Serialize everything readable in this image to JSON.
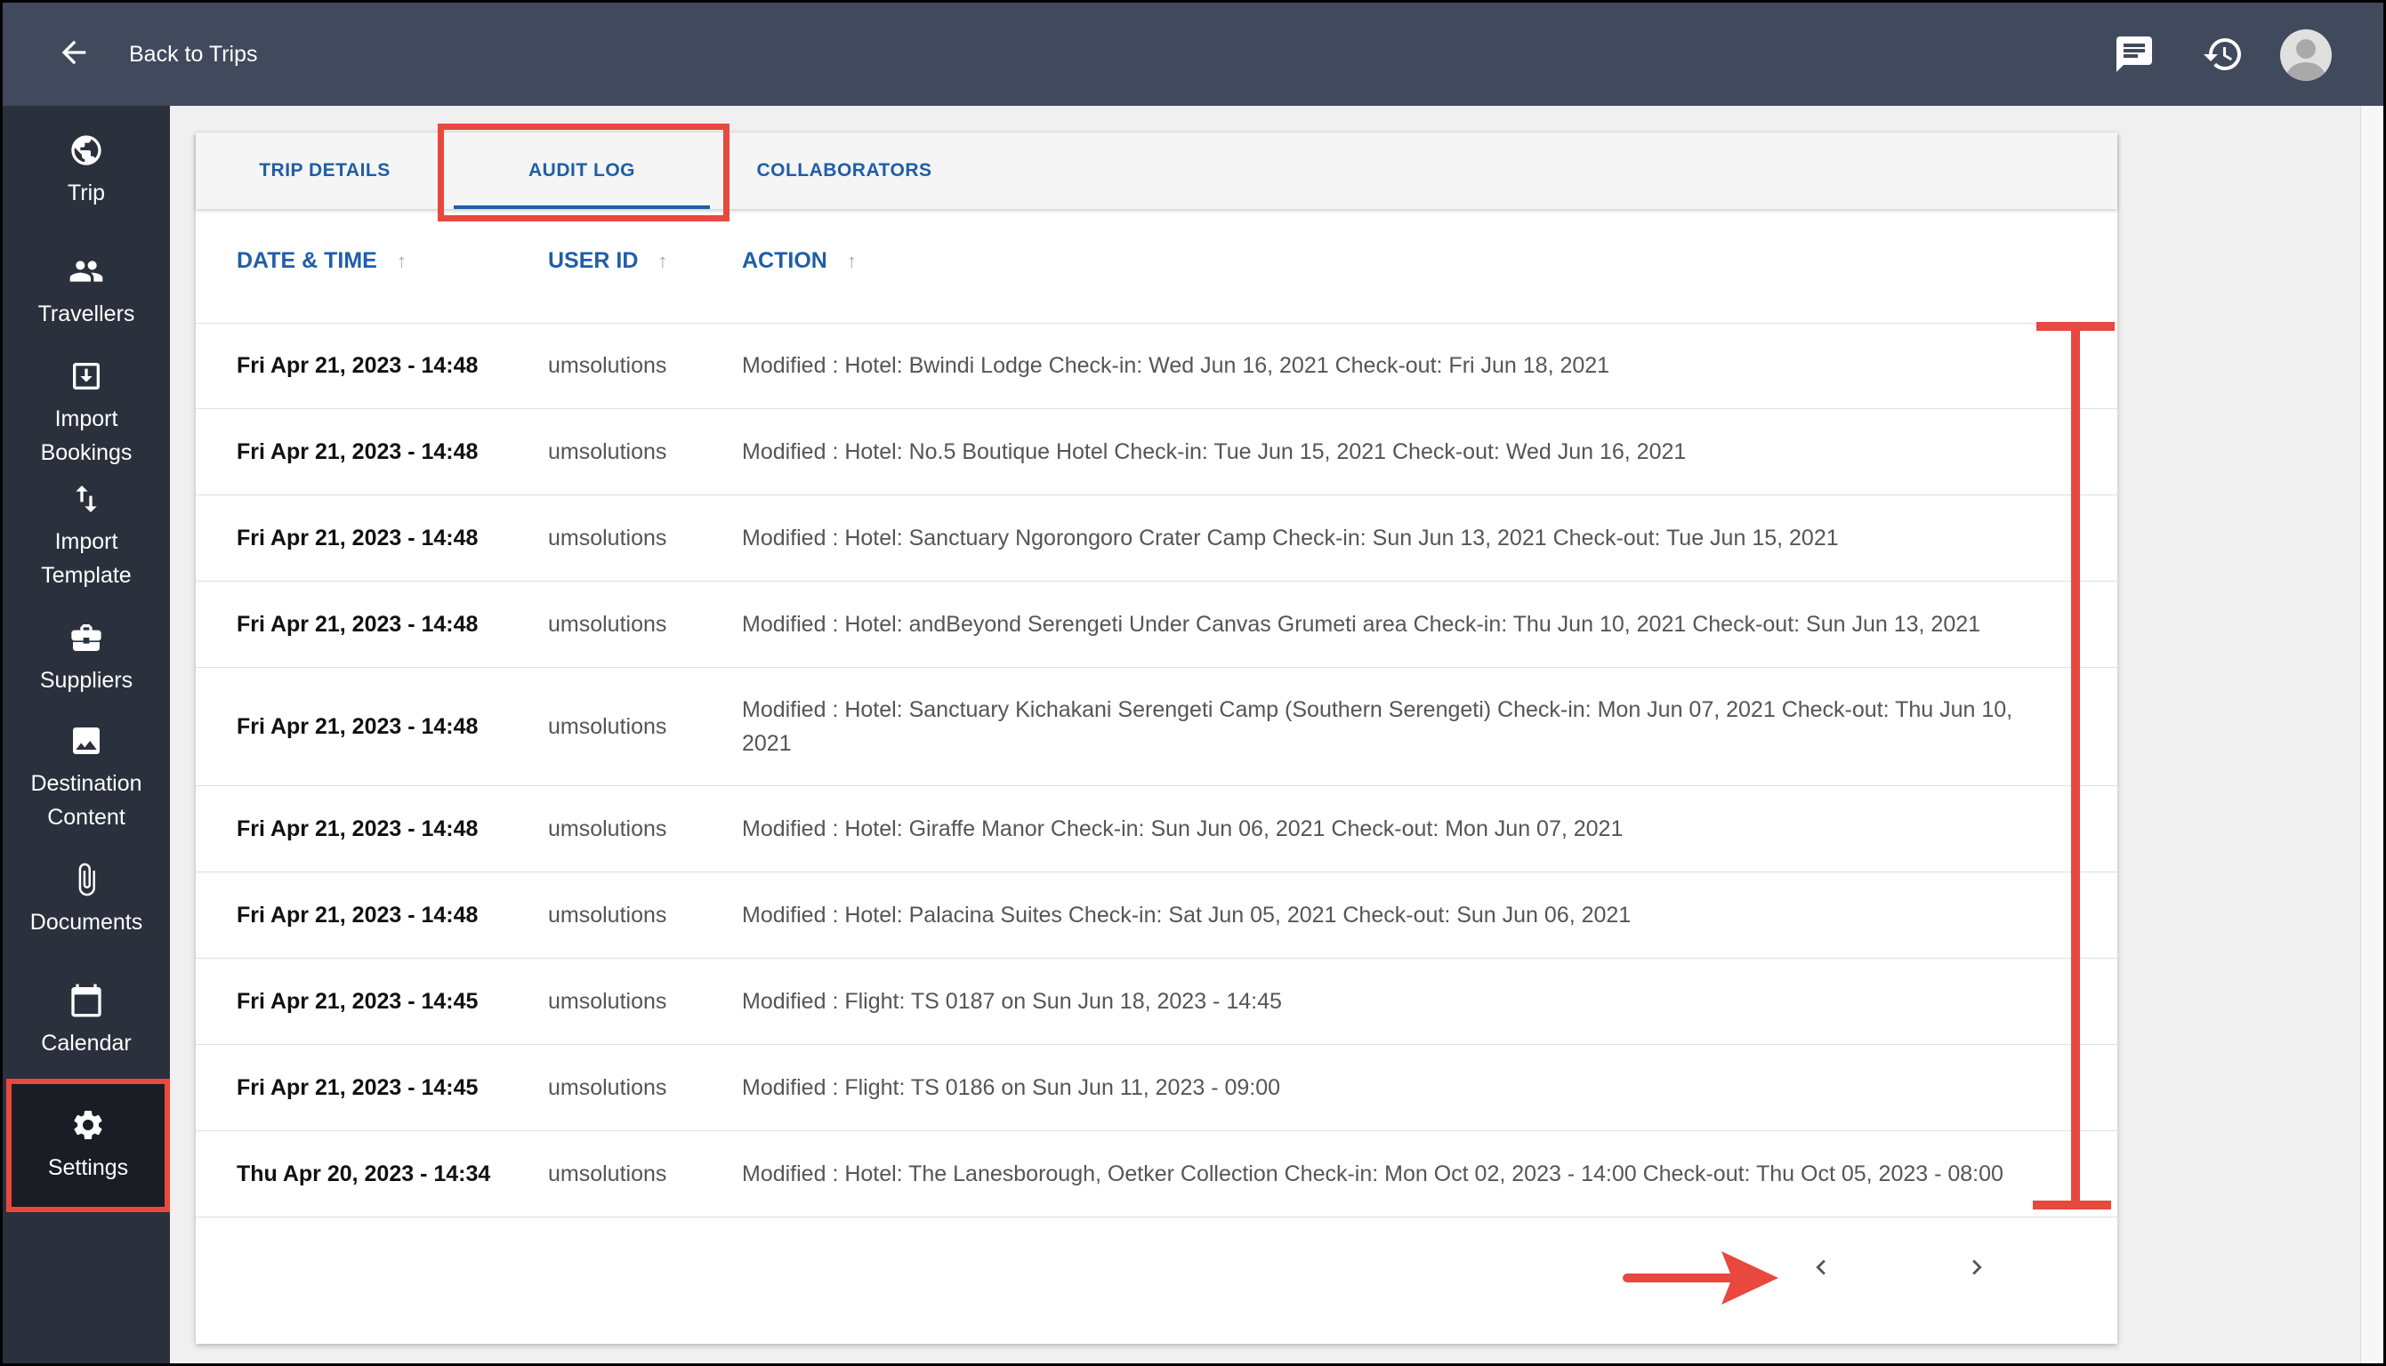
{
  "header": {
    "back_label": "Back to Trips",
    "icons": [
      "arrow-left-icon",
      "chat-icon",
      "history-icon",
      "user-avatar"
    ]
  },
  "sidebar": {
    "items": [
      {
        "label": "Trip",
        "icon": "globe-icon"
      },
      {
        "label": "Travellers",
        "icon": "people-icon"
      },
      {
        "label": "Import\nBookings",
        "icon": "import-icon"
      },
      {
        "label": "Import\nTemplate",
        "icon": "swap-vertical-icon"
      },
      {
        "label": "Suppliers",
        "icon": "briefcase-icon"
      },
      {
        "label": "Destination\nContent",
        "icon": "image-icon"
      },
      {
        "label": "Documents",
        "icon": "paperclip-icon"
      },
      {
        "label": "Calendar",
        "icon": "calendar-icon"
      },
      {
        "label": "Settings",
        "icon": "gear-icon",
        "selected": true
      }
    ]
  },
  "tabs": [
    {
      "label": "TRIP DETAILS"
    },
    {
      "label": "AUDIT LOG",
      "active": true
    },
    {
      "label": "COLLABORATORS"
    }
  ],
  "table": {
    "columns": [
      "DATE & TIME",
      "USER ID",
      "ACTION"
    ],
    "rows": [
      {
        "date": "Fri Apr 21, 2023 - 14:48",
        "user": "umsolutions",
        "action": "Modified : Hotel: Bwindi Lodge Check-in: Wed Jun 16, 2021 Check-out: Fri Jun 18, 2021"
      },
      {
        "date": "Fri Apr 21, 2023 - 14:48",
        "user": "umsolutions",
        "action": "Modified : Hotel: No.5 Boutique Hotel Check-in: Tue Jun 15, 2021 Check-out: Wed Jun 16, 2021"
      },
      {
        "date": "Fri Apr 21, 2023 - 14:48",
        "user": "umsolutions",
        "action": "Modified : Hotel: Sanctuary Ngorongoro Crater Camp Check-in: Sun Jun 13, 2021 Check-out: Tue Jun 15, 2021"
      },
      {
        "date": "Fri Apr 21, 2023 - 14:48",
        "user": "umsolutions",
        "action": "Modified : Hotel: andBeyond Serengeti Under Canvas Grumeti area Check-in: Thu Jun 10, 2021 Check-out: Sun Jun 13, 2021"
      },
      {
        "date": "Fri Apr 21, 2023 - 14:48",
        "user": "umsolutions",
        "action": "Modified : Hotel: Sanctuary Kichakani Serengeti Camp (Southern Serengeti) Check-in: Mon Jun 07, 2021 Check-out: Thu Jun 10, 2021"
      },
      {
        "date": "Fri Apr 21, 2023 - 14:48",
        "user": "umsolutions",
        "action": "Modified : Hotel: Giraffe Manor Check-in: Sun Jun 06, 2021 Check-out: Mon Jun 07, 2021"
      },
      {
        "date": "Fri Apr 21, 2023 - 14:48",
        "user": "umsolutions",
        "action": "Modified : Hotel: Palacina Suites Check-in: Sat Jun 05, 2021 Check-out: Sun Jun 06, 2021"
      },
      {
        "date": "Fri Apr 21, 2023 - 14:45",
        "user": "umsolutions",
        "action": "Modified : Flight: TS 0187 on Sun Jun 18, 2023 - 14:45"
      },
      {
        "date": "Fri Apr 21, 2023 - 14:45",
        "user": "umsolutions",
        "action": "Modified : Flight: TS 0186 on Sun Jun 11, 2023 - 09:00"
      },
      {
        "date": "Thu Apr 20, 2023 - 14:34",
        "user": "umsolutions",
        "action": "Modified : Hotel: The Lanesborough, Oetker Collection Check-in: Mon Oct 02, 2023 - 14:00 Check-out: Thu Oct 05, 2023 - 08:00"
      }
    ]
  },
  "pagination": {
    "icons": [
      "chevron-left-icon",
      "chevron-right-icon"
    ]
  },
  "colors": {
    "topbar": "#414a5c",
    "sidebar": "#2b303d",
    "accent": "#1f5ea8",
    "annotation": "#e8483e"
  }
}
